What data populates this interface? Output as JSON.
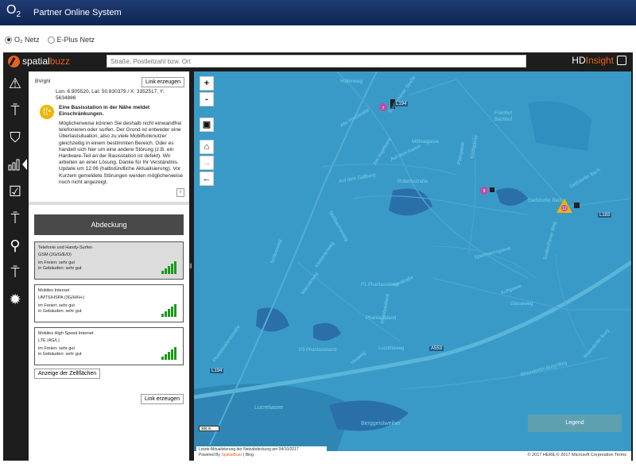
{
  "header": {
    "logo": "O",
    "logo_sub": "2",
    "title": "Partner Online System"
  },
  "networks": [
    {
      "label": "O₂ Netz",
      "selected": true
    },
    {
      "label": "E-Plus Netz",
      "selected": false
    }
  ],
  "appbar": {
    "brand_spatial": "spatial",
    "brand_buzz": "buzz",
    "search_placeholder": "Straße, Postleitzahl bzw. Ort",
    "hd_a": "HD",
    "hd_b": "Insight"
  },
  "rail": [
    {
      "icon": "warning-icon",
      "glyph": "⚠"
    },
    {
      "icon": "tower-icon",
      "glyph": "⍑"
    },
    {
      "icon": "basket-icon",
      "glyph": "⛉"
    },
    {
      "icon": "bar-chart-icon",
      "glyph": "▮",
      "active": true
    },
    {
      "icon": "checklist-icon",
      "glyph": "☑"
    },
    {
      "icon": "tower-minus-icon",
      "glyph": "⍑"
    },
    {
      "icon": "search-icon",
      "glyph": "⚲"
    },
    {
      "icon": "tower-signal-icon",
      "glyph": "⍑"
    },
    {
      "icon": "gear-icon",
      "glyph": "✹"
    }
  ],
  "info": {
    "location": "BVrghl",
    "link_label": "Link erzeugen",
    "coords": "Lon: 6.905520, Lat: 50.830379 / X: 3352517, Y: 5634886",
    "warn_title": "Eine Basisstation in der Nähe meldet Einschränkungen.",
    "warn_text": "Möglicherweise können Sie deshalb nicht einwandfrei telefonieren oder surfen. Der Grund ist entweder eine Überlastsituation, also zu viele Mobilfunknutzer gleichzeitig in einem bestimmten Bereich. Oder es handelt sich hier um eine andere Störung (z.B. ein Hardware-Teil an der Basisstation ist defekt). Wir arbeiten an einer Lösung. Danke für Ihr Verständnis. Update um 12:06 (halbstündliche Aktualisierung). Vor Kurzem gemeldete Störungen werden möglicherweise noch nicht angezeigt.",
    "info_button": "i"
  },
  "coverage": {
    "title": "Abdeckung",
    "cards": [
      {
        "name": "Telefonie und Handy-Surfen",
        "tech": "GSM (2G/G/E/O)",
        "outdoor": "im Freien: sehr gut",
        "indoor": "in Gebäuden: sehr gut",
        "level": 5,
        "selected": true
      },
      {
        "name": "Mobiles Internet",
        "tech": "UMTS/HSPA (3G/H/H+)",
        "outdoor": "im Freien: sehr gut",
        "indoor": "in Gebäuden: sehr gut",
        "level": 5,
        "selected": false
      },
      {
        "name": "Mobiles High Speed Internet",
        "tech": "LTE (4G/L)",
        "outdoor": "im Freien: sehr gut",
        "indoor": "in Gebäuden: sehr gut",
        "level": 5,
        "selected": false
      }
    ],
    "cells_button": "Anzeige der Zellflächen",
    "link_label": "Link erzeugen"
  },
  "map": {
    "zoom_in": "+",
    "zoom_out": "-",
    "legend": "Legend",
    "scale": "300 m",
    "labels": [
      "Hüllenweg",
      "Euskirchener Straße",
      "Alte Poststraße",
      "Friedhof",
      "Bachhof",
      "Am Vogelsang",
      "Möhnegasse",
      "Auf dem Kamm",
      "Pfarrgasse",
      "Kirchgasse",
      "Auf dem Gallberg",
      "Robertsstraße",
      "Geißdorfer Bach",
      "Geißdorfer Bach",
      "Schlossweg",
      "Nußbaumerweg",
      "Kastanienweg",
      "Mainzerweg",
      "Phantasialandstraße",
      "Phantasialand",
      "P1 Phantasialand",
      "Phantasialand",
      "Lucretiaweg",
      "P3 Phantasieland",
      "Kuhgasse",
      "Gässeweg",
      "Heuweg",
      "Tierstraße",
      "Spielmannsgasse",
      "Euskirchener Weg",
      "A553",
      "L194",
      "L183",
      "L194",
      "Rheindorfer-Burg-Weg",
      "Rheindorfer Burg",
      "Lucretiasee",
      "Berggeistweiher"
    ],
    "footer_update": "Letzte Aktualisierung der Netzabdeckung am 04/10/2017",
    "footer_powered": "Powered By",
    "footer_spatialbuzz": "SpatialBuzz",
    "footer_bing": "| Bing",
    "copyright": "© 2017 HERE,© 2017 Microsoft Corporation",
    "terms": "Terms",
    "site_labels": [
      "7",
      "9",
      "12"
    ]
  }
}
